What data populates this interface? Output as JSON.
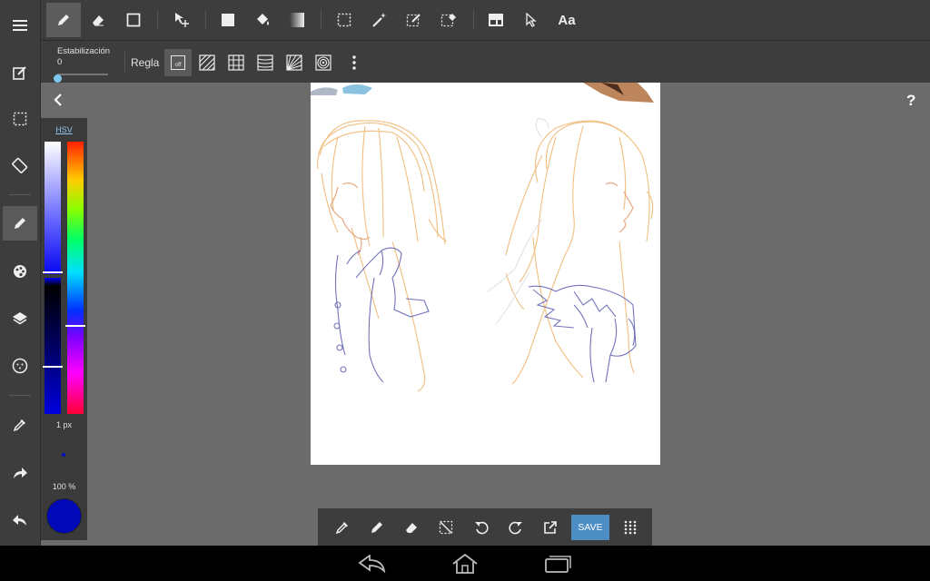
{
  "left_toolbar": {
    "tools": [
      "menu-icon",
      "edit-icon",
      "selection-icon",
      "rotate-screen-icon",
      "pen-icon",
      "palette-icon",
      "layers-icon",
      "brush-settings-icon",
      "eyedropper-icon",
      "redo-icon",
      "undo-icon"
    ],
    "active_tool": "pen-icon"
  },
  "top_toolbar": {
    "tools": [
      "pen-icon",
      "eraser-icon",
      "rectangle-icon",
      "move-icon",
      "fill-rect-icon",
      "bucket-icon",
      "gradient-icon",
      "select-rect-icon",
      "magic-wand-icon",
      "select-pen-icon",
      "select-eraser-icon",
      "panel-icon",
      "pointer-icon",
      "text-tool"
    ],
    "active_tool": "pen-icon",
    "text_tool_label": "Aa"
  },
  "sub_toolbar": {
    "stabilization_label": "Estabilización",
    "stabilization_value": "0",
    "stabilization_level": 0,
    "ruler_label": "Regla",
    "ruler_off_label": "off",
    "ruler_options": [
      "off",
      "parallel-lines",
      "grid",
      "concentric-lines",
      "perspective",
      "concentric-circles"
    ]
  },
  "color_panel": {
    "mode_label": "HSV",
    "brush_size_label": "1 px",
    "opacity_label": "100 %",
    "current_color": "#0008b8"
  },
  "bottom_toolbar": {
    "tools": [
      "eyedropper-icon",
      "pen-icon",
      "eraser-icon",
      "deselect-icon",
      "undo-icon",
      "redo-icon",
      "export-icon",
      "save-button",
      "grid-menu-icon"
    ],
    "save_label": "SAVE"
  },
  "help_label": "?",
  "colors": {
    "toolbar_bg": "#3d3d3d",
    "workspace_bg": "#6b6b6b",
    "accent": "#4c8ec4"
  }
}
